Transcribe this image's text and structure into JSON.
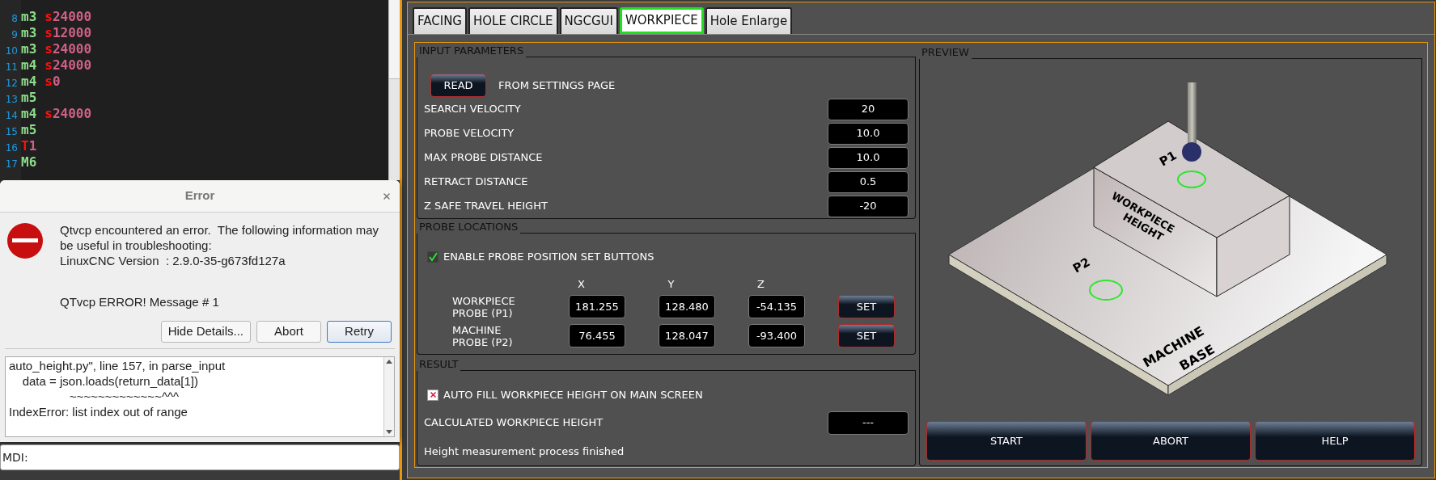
{
  "editor": {
    "lines": [
      {
        "number": "8",
        "words": [
          {
            "text": "m3",
            "kind": "mcode"
          },
          {
            "text": "s24000",
            "kind": "param"
          }
        ]
      },
      {
        "number": "9",
        "words": [
          {
            "text": "m3",
            "kind": "mcode"
          },
          {
            "text": "s12000",
            "kind": "param"
          }
        ]
      },
      {
        "number": "10",
        "words": [
          {
            "text": "m3",
            "kind": "mcode"
          },
          {
            "text": "s24000",
            "kind": "param"
          }
        ]
      },
      {
        "number": "11",
        "words": [
          {
            "text": "m4",
            "kind": "mcode"
          },
          {
            "text": "s24000",
            "kind": "param"
          }
        ]
      },
      {
        "number": "12",
        "words": [
          {
            "text": "m4",
            "kind": "mcode"
          },
          {
            "text": "s0",
            "kind": "param"
          }
        ]
      },
      {
        "number": "13",
        "words": [
          {
            "text": "m5",
            "kind": "mcode"
          }
        ]
      },
      {
        "number": "14",
        "words": [
          {
            "text": "m4",
            "kind": "mcode"
          },
          {
            "text": "s24000",
            "kind": "param"
          }
        ]
      },
      {
        "number": "15",
        "words": [
          {
            "text": "m5",
            "kind": "mcode"
          }
        ]
      },
      {
        "number": "16",
        "words": [
          {
            "text": "T1",
            "kind": "param"
          }
        ]
      },
      {
        "number": "17",
        "words": [
          {
            "text": "M6",
            "kind": "mcode"
          }
        ]
      }
    ]
  },
  "error_dialog": {
    "title": "Error",
    "message": "Qtvcp encountered an error.  The following information may be useful in troubleshooting:",
    "version": "LinuxCNC Version  : 2.9.0-35-g673fd127a",
    "detail_header": "QTvcp ERROR! Message # 1",
    "buttons": [
      {
        "label": "Hide Details...",
        "selected": false
      },
      {
        "label": "Abort",
        "selected": false
      },
      {
        "label": "Retry",
        "selected": true
      }
    ],
    "details": [
      "auto_height.py\", line 157, in parse_input",
      "    data = json.loads(return_data[1])",
      "                  ~~~~~~~~~~~~~^^^",
      "IndexError: list index out of range"
    ]
  },
  "mdi": {
    "label": "MDI:"
  },
  "tabs": [
    {
      "label": "FACING",
      "selected": false
    },
    {
      "label": "HOLE CIRCLE",
      "selected": false
    },
    {
      "label": "NGCGUI",
      "selected": false
    },
    {
      "label": "WORKPIECE",
      "selected": true
    },
    {
      "label": "Hole Enlarge",
      "selected": false
    }
  ],
  "input_parameters": {
    "title": "INPUT PARAMETERS",
    "read_button": "READ",
    "read_note": "FROM SETTINGS PAGE",
    "rows": [
      {
        "label": "SEARCH VELOCITY",
        "value": "20"
      },
      {
        "label": "PROBE VELOCITY",
        "value": "10.0"
      },
      {
        "label": "MAX PROBE DISTANCE",
        "value": "10.0"
      },
      {
        "label": "RETRACT DISTANCE",
        "value": "0.5"
      },
      {
        "label": "Z SAFE TRAVEL HEIGHT",
        "value": "-20"
      }
    ]
  },
  "probe_locations": {
    "title": "PROBE LOCATIONS",
    "enable": {
      "label": "ENABLE PROBE POSITION SET BUTTONS",
      "checked": true,
      "kind": "tick"
    },
    "columns": [
      "X",
      "Y",
      "Z"
    ],
    "rows": [
      {
        "label": "WORKPIECE PROBE (P1)",
        "values": [
          "181.255",
          "128.480",
          "-54.135"
        ],
        "button": "SET"
      },
      {
        "label": "MACHINE PROBE (P2)",
        "values": [
          "76.455",
          "128.047",
          "-93.400"
        ],
        "button": "SET"
      }
    ]
  },
  "result": {
    "title": "RESULT",
    "auto_fill": {
      "label": "AUTO FILL WORKPIECE HEIGHT ON MAIN SCREEN",
      "checked": true,
      "kind": "cross"
    },
    "calculated": {
      "label": "CALCULATED WORKPIECE HEIGHT",
      "value": "---"
    },
    "status": "Height measurement process finished"
  },
  "preview": {
    "title": "PREVIEW",
    "labels": {
      "p1": "P1",
      "p2": "P2",
      "workpiece": [
        "WORKPIECE",
        "HEIGHT"
      ],
      "base": [
        "MACHINE",
        "BASE"
      ]
    },
    "buttons": [
      "START",
      "ABORT",
      "HELP"
    ]
  }
}
